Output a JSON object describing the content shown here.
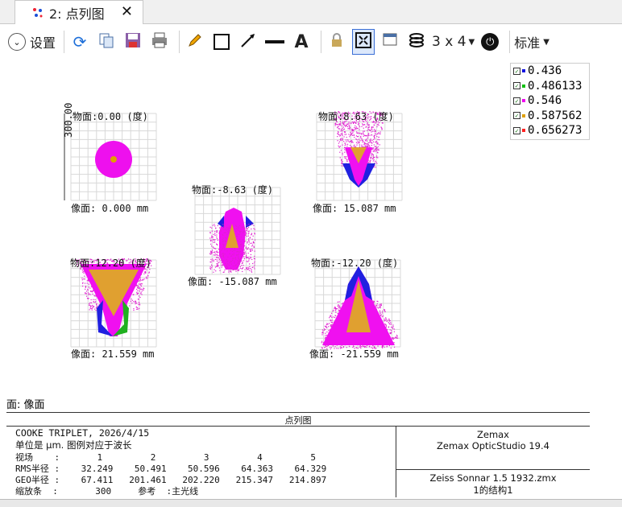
{
  "tab": {
    "title": "2: 点列图"
  },
  "toolbar": {
    "settings_label": "设置",
    "layout_label": "3 x 4",
    "standard_label": "标准"
  },
  "legend": [
    {
      "value": "0.436",
      "color": "#1010e0"
    },
    {
      "value": "0.486133",
      "color": "#10c010"
    },
    {
      "value": "0.546",
      "color": "#f000f0"
    },
    {
      "value": "0.587562",
      "color": "#e0a000"
    },
    {
      "value": "0.656273",
      "color": "#ff2020"
    }
  ],
  "plots": [
    {
      "obj": "物面:0.00 (度)",
      "img": "像面: 0.000 mm"
    },
    {
      "obj": "物面:8.63 (度)",
      "img": "像面: 15.087 mm"
    },
    {
      "obj": "物面:-8.63 (度)",
      "img": "像面: -15.087 mm"
    },
    {
      "obj": "物面:12.20 (度)",
      "img": "像面: 21.559 mm"
    },
    {
      "obj": "物面:-12.20 (度)",
      "img": "像面: -21.559 mm"
    }
  ],
  "scale_label": "300.00",
  "surface_label": "面: 像面",
  "footer": {
    "title": "点列图",
    "line1": "COOKE TRIPLET, 2026/4/15",
    "line2": "单位是 μm. 图例对应于波长",
    "line3": "视场    :       1         2         3         4         5",
    "line4": "RMS半径 :    32.249    50.491    50.596    64.363    64.329",
    "line5": "GEO半径 :    67.411   201.461   202.220   215.347   214.897",
    "line6": "缩放条  :       300     参考  :主光线",
    "right1": "Zemax",
    "right2": "Zemax OpticStudio 19.4",
    "right3": "Zeiss Sonnar 1.5 1932.zmx",
    "right4": "1的结构1"
  }
}
